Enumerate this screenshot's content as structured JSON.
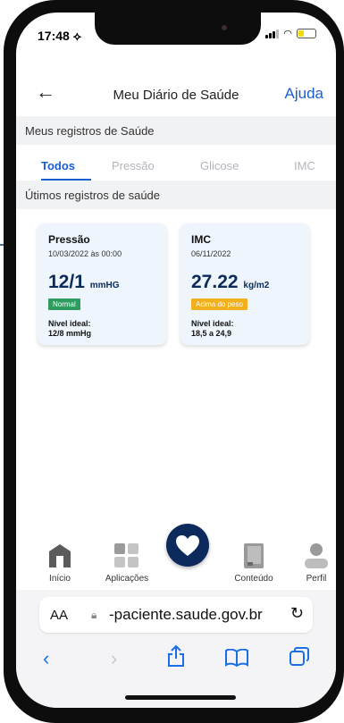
{
  "status_bar": {
    "time": "17:48 ⟡"
  },
  "header": {
    "back_icon": "arrow-left-icon",
    "title": "Meu Diário de Saúde",
    "help_label": "Ajuda"
  },
  "section1": "Meus registros de Saúde",
  "tabs": [
    "Todos",
    "Pressão",
    "Glicose",
    "IMC"
  ],
  "section2": "Útimos registros de saúde",
  "cards": [
    {
      "title": "Pressão",
      "date": "10/03/2022 às 00:00",
      "value": "12/1",
      "unit": "mmHG",
      "badge": "Normal",
      "badge_color": "#2e9c5f",
      "ideal_label": "Nível ideal:",
      "ideal_value": "12/8 mmHg"
    },
    {
      "title": "IMC",
      "date": "06/11/2022",
      "value": "27.22",
      "unit": "kg/m2",
      "badge": "Acima do peso",
      "badge_color": "#f2b01e",
      "ideal_label": "Nível ideal:",
      "ideal_value": "18,5 a 24,9"
    }
  ],
  "bottom_nav": [
    {
      "label": "Início",
      "icon": "home-icon"
    },
    {
      "label": "Aplicações",
      "icon": "grid-icon"
    },
    {
      "label": "Conteúdo",
      "icon": "book-icon"
    },
    {
      "label": "Perfil",
      "icon": "person-icon"
    }
  ],
  "fab_icon": "heart-icon",
  "safari": {
    "aa": "AA",
    "url": "-paciente.saude.gov.br"
  },
  "colors": {
    "accent": "#1a5fd0",
    "navy": "#0d2a5c",
    "card_bg": "#eef5fc"
  }
}
